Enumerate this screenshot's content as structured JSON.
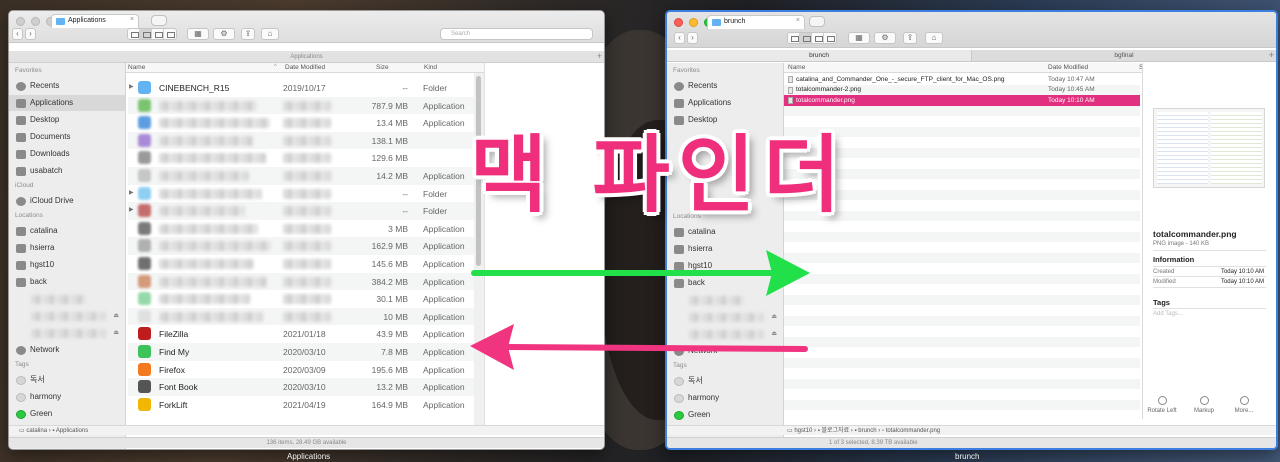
{
  "left_window": {
    "tab_title": "Applications",
    "search_placeholder": "Search",
    "path_title": "Applications",
    "sidebar": {
      "favorites_header": "Favorites",
      "favorites": [
        "Recents",
        "Applications",
        "Desktop",
        "Documents",
        "Downloads",
        "usabatch"
      ],
      "icloud_header": "iCloud",
      "icloud": [
        "iCloud Drive"
      ],
      "locations_header": "Locations",
      "locations": [
        "catalina",
        "hsierra",
        "hgst10",
        "back"
      ],
      "network": "Network",
      "tags_header": "Tags",
      "tags": [
        "독서",
        "harmony",
        "Green"
      ]
    },
    "columns": {
      "name": "Name",
      "date": "Date Modified",
      "size": "Size",
      "kind": "Kind"
    },
    "rows": [
      {
        "name": "CINEBENCH_R15",
        "date": "2019/10/17",
        "size": "--",
        "kind": "Folder",
        "icon": "folder",
        "expand": true
      },
      {
        "name": "",
        "date": "",
        "size": "787.9 MB",
        "kind": "Application"
      },
      {
        "name": "",
        "date": "",
        "size": "13.4 MB",
        "kind": "Application"
      },
      {
        "name": "",
        "date": "",
        "size": "138.1 MB",
        "kind": ""
      },
      {
        "name": "",
        "date": "",
        "size": "129.6 MB",
        "kind": ""
      },
      {
        "name": "",
        "date": "",
        "size": "14.2 MB",
        "kind": "Application"
      },
      {
        "name": "",
        "date": "",
        "size": "--",
        "kind": "Folder",
        "expand": true
      },
      {
        "name": "",
        "date": "",
        "size": "--",
        "kind": "Folder",
        "expand": true
      },
      {
        "name": "",
        "date": "",
        "size": "3 MB",
        "kind": "Application"
      },
      {
        "name": "",
        "date": "",
        "size": "162.9 MB",
        "kind": "Application"
      },
      {
        "name": "",
        "date": "",
        "size": "145.6 MB",
        "kind": "Application"
      },
      {
        "name": "",
        "date": "",
        "size": "384.2 MB",
        "kind": "Application"
      },
      {
        "name": "",
        "date": "",
        "size": "30.1 MB",
        "kind": "Application"
      },
      {
        "name": "",
        "date": "",
        "size": "10 MB",
        "kind": "Application"
      },
      {
        "name": "FileZilla",
        "date": "2021/01/18",
        "size": "43.9 MB",
        "kind": "Application",
        "icon": "filezilla"
      },
      {
        "name": "Find My",
        "date": "2020/03/10",
        "size": "7.8 MB",
        "kind": "Application",
        "icon": "findmy"
      },
      {
        "name": "Firefox",
        "date": "2020/03/09",
        "size": "195.6 MB",
        "kind": "Application",
        "icon": "firefox"
      },
      {
        "name": "Font Book",
        "date": "2020/03/10",
        "size": "13.2 MB",
        "kind": "Application",
        "icon": "fontbook"
      },
      {
        "name": "ForkLift",
        "date": "2021/04/19",
        "size": "164.9 MB",
        "kind": "Application",
        "icon": "forklift"
      }
    ],
    "breadcrumb": [
      "catalina",
      "Applications"
    ],
    "status": "136 items, 28.49 GB available",
    "caption": "Applications"
  },
  "right_window": {
    "tab_title": "brunch",
    "path_tabs": [
      "brunch",
      "bgfinal"
    ],
    "sidebar": {
      "favorites_header": "Favorites",
      "favorites": [
        "Recents",
        "Applications",
        "Desktop"
      ],
      "locations_header": "Locations",
      "locations": [
        "catalina",
        "hsierra",
        "hgst10",
        "back"
      ],
      "network": "Network",
      "tags_header": "Tags",
      "tags": [
        "독서",
        "harmony",
        "Green"
      ]
    },
    "columns": {
      "name": "Name",
      "date": "Date Modified",
      "size": "S"
    },
    "files": [
      {
        "name": "catalina_and_Commander_One_-_secure_FTP_client_for_Mac_OS.png",
        "date": "Today 10:47 AM"
      },
      {
        "name": "totalcommander-2.png",
        "date": "Today 10:45 AM"
      },
      {
        "name": "totalcommander.png",
        "date": "Today 10:10 AM",
        "selected": true
      }
    ],
    "preview": {
      "filename": "totalcommander.png",
      "type": "PNG image - 140 KB",
      "info_header": "Information",
      "created_label": "Created",
      "created_value": "Today 10:10 AM",
      "modified_label": "Modified",
      "modified_value": "Today 10:10 AM",
      "tags_header": "Tags",
      "tags_placeholder": "Add Tags...",
      "actions": [
        "Rotate Left",
        "Markup",
        "More..."
      ]
    },
    "breadcrumb": [
      "hgst10",
      "블로그자료",
      "brunch",
      "totalcommander.png"
    ],
    "status": "1 of 3 selected, 8.39 TB available",
    "caption": "brunch"
  },
  "overlay_title": "맥 파인더",
  "colors": {
    "accent": "#ef2f7c",
    "arrow_green": "#22e04a",
    "arrow_pink": "#f0347f",
    "selection": "#e0307f",
    "focus_border": "#3d7fe0"
  }
}
